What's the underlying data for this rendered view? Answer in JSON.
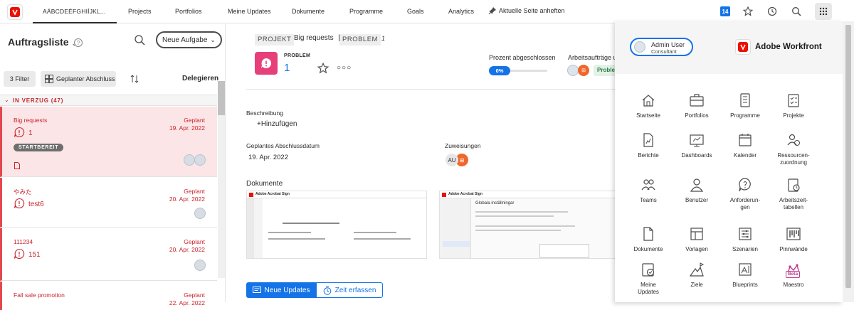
{
  "nav": {
    "first_item": "AÄBCDEÉFGHIÍJKL...",
    "items": [
      "Projects",
      "Portfolios",
      "Meine Updates",
      "Dokumente",
      "Programme",
      "Goals",
      "Analytics"
    ],
    "pin_label": "Aktuelle Seite anheften",
    "notification_count": "14"
  },
  "left": {
    "title": "Auftragsliste",
    "new_task": "Neue Aufgabe",
    "filter": "3  Filter",
    "planned": "Geplanter Abschluss",
    "delegate": "Delegieren",
    "group_label": "IN VERZUG (47)",
    "tasks": [
      {
        "title": "Big requests",
        "number": "1",
        "status": "Geplant",
        "date": "19. Apr. 2022",
        "badge": "STARTBEREIT"
      },
      {
        "title": "やみた",
        "number": "test6",
        "status": "Geplant",
        "date": "20. Apr. 2022"
      },
      {
        "title": "111234",
        "number": "151",
        "status": "Geplant",
        "date": "20. Apr. 2022"
      },
      {
        "title": "Fall sale promotion",
        "number": "",
        "status": "Geplant",
        "date": "22. Apr. 2022"
      }
    ]
  },
  "center": {
    "crumb_project": "PROJEKT",
    "crumb_project_title": "Big requests",
    "crumb_issue": "PROBLEM",
    "crumb_issue_num": "1",
    "issue_type": "PROBLEM",
    "issue_number": "1",
    "percent_label": "Prozent abgeschlossen",
    "percent_value": "0%",
    "requests_label": "Arbeitsaufträge und",
    "requests_tag": "Proble",
    "description_label": "Beschreibung",
    "description_add": "+Hinzufügen",
    "due_label": "Geplantes Abschlussdatum",
    "due_value": "19. Apr. 2022",
    "assign_label": "Zuweisungen",
    "assign_initials": "AU",
    "docs_label": "Dokumente",
    "doc1_brand": "Adobe Acrobat Sign",
    "doc2_brand": "Adobe Acrobat Sign",
    "doc2_heading": "Globala inställningar",
    "btn_updates": "Neue Updates",
    "btn_time": "Zeit erfassen"
  },
  "panel": {
    "user_name": "Admin User",
    "user_role": "Consultant",
    "brand": "Adobe Workfront",
    "apps": [
      {
        "label": "Startseite",
        "icon": "home-icon"
      },
      {
        "label": "Portfolios",
        "icon": "briefcase-icon"
      },
      {
        "label": "Programme",
        "icon": "program-icon"
      },
      {
        "label": "Projekte",
        "icon": "project-icon"
      },
      {
        "label": "Berichte",
        "icon": "report-icon"
      },
      {
        "label": "Dashboards",
        "icon": "dashboard-icon"
      },
      {
        "label": "Kalender",
        "icon": "calendar-icon"
      },
      {
        "label": "Ressourcen-\nzuordnung",
        "icon": "resource-icon"
      },
      {
        "label": "Teams",
        "icon": "teams-icon"
      },
      {
        "label": "Benutzer",
        "icon": "user-icon"
      },
      {
        "label": "Anforderun-\ngen",
        "icon": "request-icon"
      },
      {
        "label": "Arbeitszeit-\ntabellen",
        "icon": "timesheet-icon"
      },
      {
        "label": "Dokumente",
        "icon": "document-icon"
      },
      {
        "label": "Vorlagen",
        "icon": "template-icon"
      },
      {
        "label": "Szenarien",
        "icon": "scenario-icon"
      },
      {
        "label": "Pinnwände",
        "icon": "board-icon"
      },
      {
        "label": "Meine\nUpdates",
        "icon": "updates-icon"
      },
      {
        "label": "Ziele",
        "icon": "goals-icon"
      },
      {
        "label": "Blueprints",
        "icon": "blueprint-icon"
      },
      {
        "label": "Maestro",
        "icon": "maestro-icon",
        "badge": "Beta"
      }
    ]
  },
  "colors": {
    "accent": "#1473e6",
    "danger": "#c9252d",
    "brand_red": "#eb1000",
    "issue_pink": "#e63f7a"
  }
}
